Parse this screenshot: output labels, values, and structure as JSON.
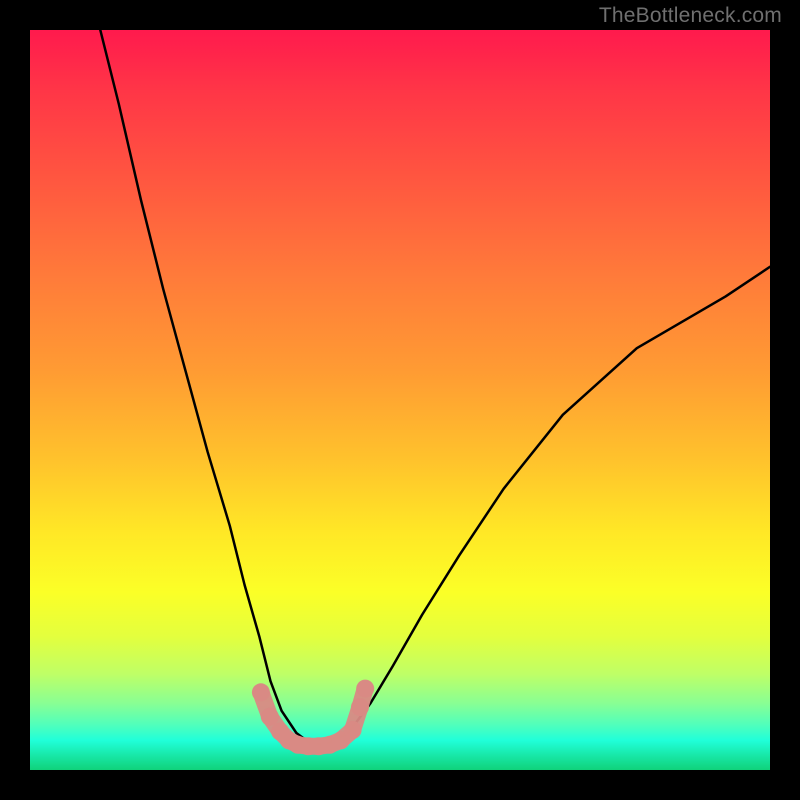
{
  "watermark": "TheBottleneck.com",
  "chart_data": {
    "type": "line",
    "title": "",
    "xlabel": "",
    "ylabel": "",
    "xlim": [
      0,
      100
    ],
    "ylim": [
      0,
      100
    ],
    "grid": false,
    "legend": false,
    "background": "vertical-gradient red→orange→yellow→green",
    "series": [
      {
        "name": "curve",
        "color": "#000000",
        "x": [
          9.5,
          12,
          15,
          18,
          21,
          24,
          27,
          29,
          31,
          32.5,
          34,
          36,
          38,
          40,
          43,
          46,
          49,
          53,
          58,
          64,
          72,
          82,
          94,
          100
        ],
        "y": [
          100,
          90,
          77,
          65,
          54,
          43,
          33,
          25,
          18,
          12,
          8,
          5,
          3.5,
          3.5,
          5,
          9,
          14,
          21,
          29,
          38,
          48,
          57,
          64,
          68
        ]
      },
      {
        "name": "markers",
        "color": "#d98a84",
        "marker": "round",
        "x": [
          31.2,
          32.4,
          33.8,
          35.0,
          36.2,
          37.6,
          39.0,
          40.5,
          42.0,
          43.6,
          44.6,
          45.3
        ],
        "y": [
          10.5,
          7.2,
          5.2,
          4.0,
          3.4,
          3.2,
          3.2,
          3.4,
          4.0,
          5.4,
          8.5,
          11.0
        ]
      }
    ]
  }
}
